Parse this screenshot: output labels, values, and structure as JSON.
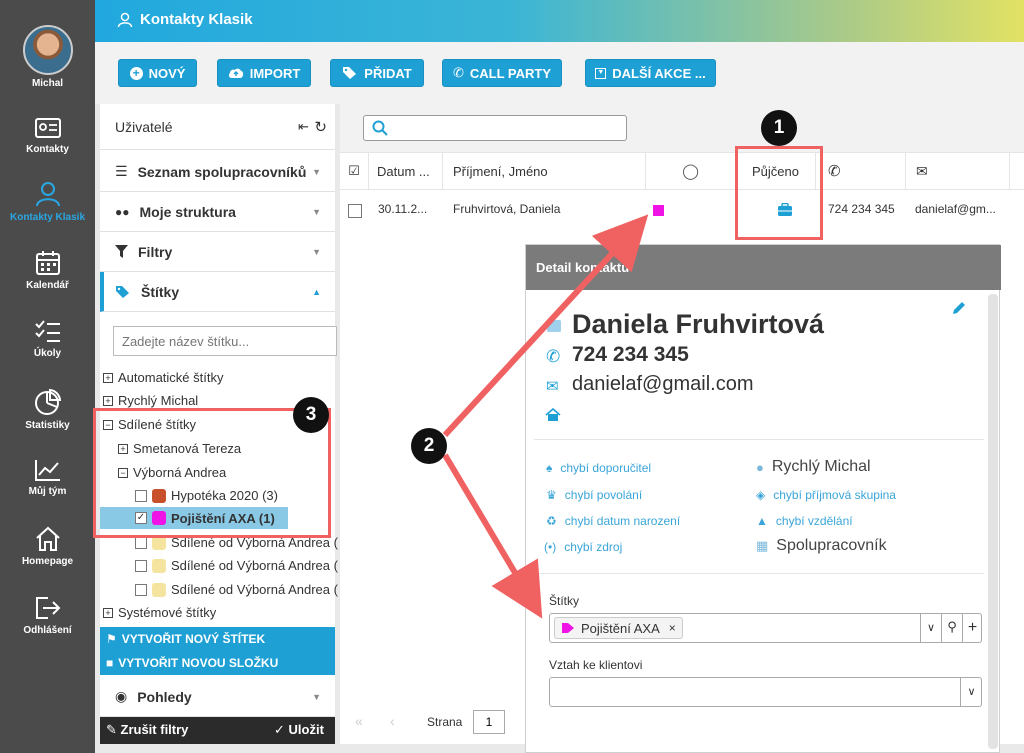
{
  "user": {
    "name": "Michal"
  },
  "nav": [
    {
      "label": "Kontakty",
      "icon": "contact-card-icon"
    },
    {
      "label": "Kontakty Klasik",
      "icon": "user-icon"
    },
    {
      "label": "Kalendář",
      "icon": "calendar-icon"
    },
    {
      "label": "Úkoly",
      "icon": "tasks-icon"
    },
    {
      "label": "Statistiky",
      "icon": "pie-chart-icon"
    },
    {
      "label": "Můj tým",
      "icon": "trend-chart-icon"
    },
    {
      "label": "Homepage",
      "icon": "home-icon"
    },
    {
      "label": "Odhlášení",
      "icon": "logout-icon"
    }
  ],
  "header": {
    "title": "Kontakty Klasik"
  },
  "toolbar": {
    "new": "NOVÝ",
    "import": "IMPORT",
    "add": "PŘIDAT",
    "call_party": "CALL PARTY",
    "more": "DALŠÍ AKCE ..."
  },
  "left_panel": {
    "title": "Uživatelé",
    "sections": {
      "collaborators": "Seznam spolupracovníků",
      "structure": "Moje struktura",
      "filters": "Filtry",
      "tags": "Štítky",
      "views": "Pohledy"
    },
    "tag_search_placeholder": "Zadejte název štítku...",
    "tree": {
      "auto": "Automatické štítky",
      "rychly": "Rychlý Michal",
      "shared": "Sdílené štítky",
      "smetanova": "Smetanová Tereza",
      "vyborna": "Výborná Andrea",
      "hypoteka": "Hypotéka 2020 (3)",
      "pojisteni": "Pojištění AXA (1)",
      "shared_from_1": "Sdílené od Výborná Andrea (",
      "shared_from_2": "Sdílené od Výborná Andrea (",
      "shared_from_3": "Sdílené od Výborná Andrea (",
      "system": "Systémové štítky"
    },
    "create_tag": "VYTVOŘIT NOVÝ ŠTÍTEK",
    "create_folder": "VYTVOŘIT NOVOU SLOŽKU",
    "clear_filters": "Zrušit filtry",
    "save": "Uložit"
  },
  "grid": {
    "columns": [
      "Datum ...",
      "Příjmení, Jméno",
      "Půjčeno"
    ],
    "row": {
      "date": "30.11.2...",
      "name": "Fruhvirtová, Daniela",
      "phone": "724 234 345",
      "email": "danielaf@gm..."
    },
    "pager": {
      "label": "Strana",
      "page": "1"
    }
  },
  "detail": {
    "title": "Detail kontaktu",
    "name": "Daniela Fruhvirtová",
    "phone": "724 234 345",
    "email": "danielaf@gmail.com",
    "info_left": [
      "chybí doporučitel",
      "chybí povolání",
      "chybí datum narození",
      "chybí zdroj"
    ],
    "info_right": [
      "Rychlý Michal",
      "chybí příjmová skupina",
      "chybí vzdělání",
      "Spolupracovník"
    ],
    "tags_label": "Štítky",
    "tag_chip": "Pojištění AXA",
    "relation_label": "Vztah ke klientovi"
  },
  "annotations": [
    "1",
    "2",
    "3"
  ],
  "colors": {
    "accent": "#1fa0d5",
    "nav_bg": "#4b4b4b",
    "tag_magenta": "#f013e6",
    "tag_brown": "#c8502a",
    "highlight": "#f06262"
  }
}
